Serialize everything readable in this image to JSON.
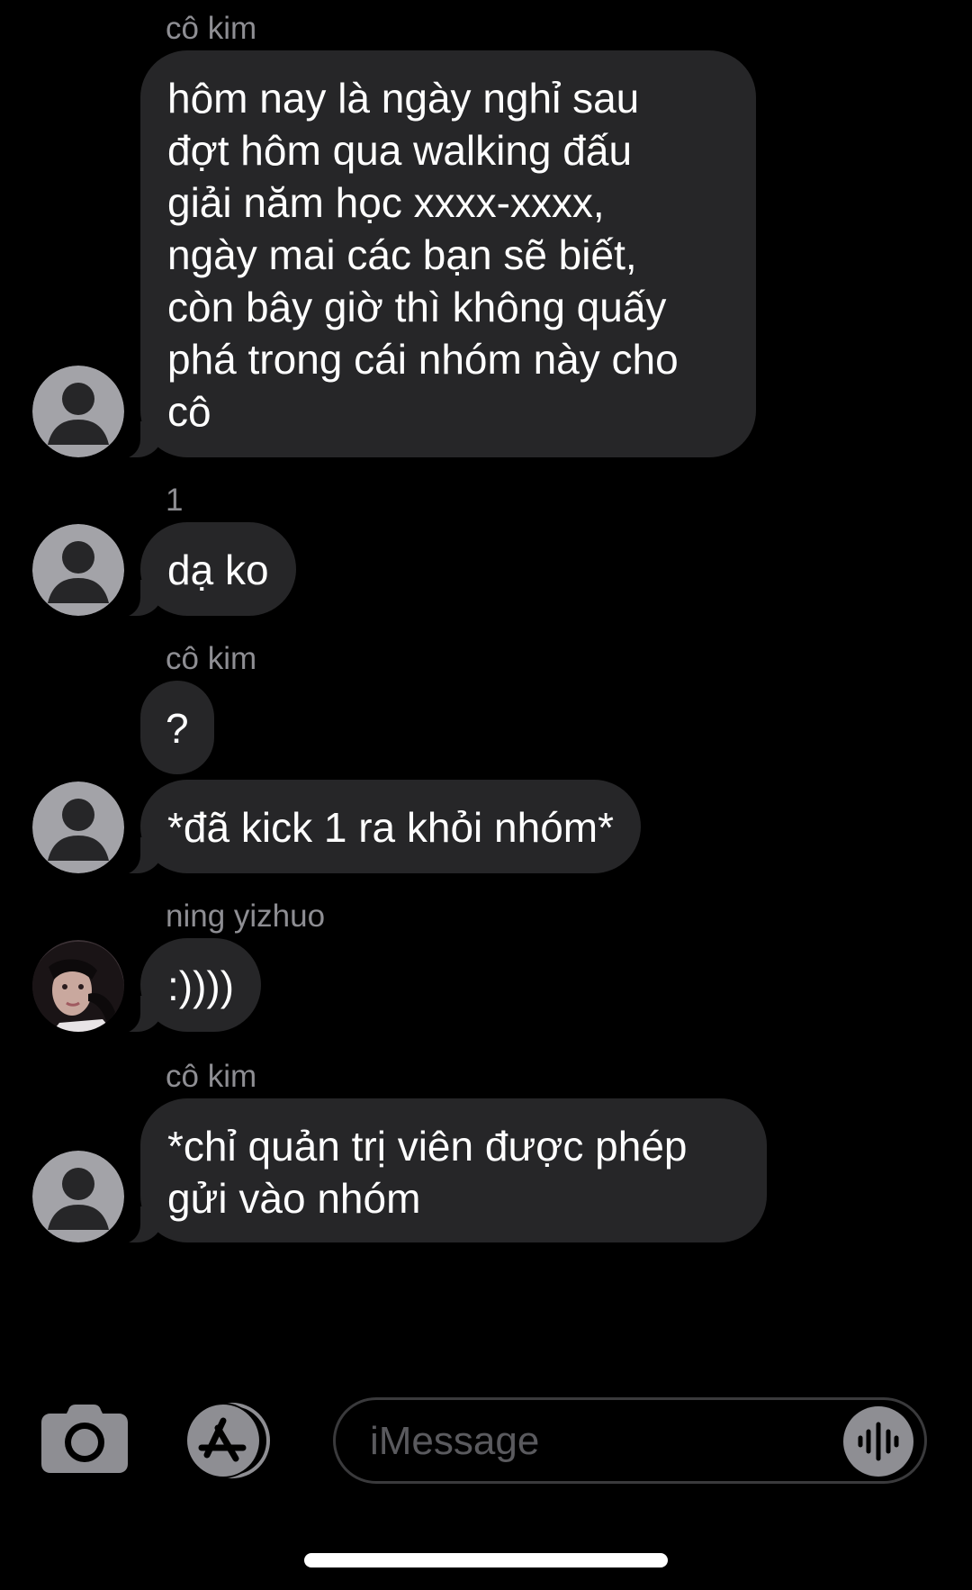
{
  "messages": [
    {
      "sender": "cô kim",
      "text": "hôm nay là ngày nghỉ sau\nđợt hôm qua walking đấu\ngiải năm học xxxx-xxxx,\nngày mai các bạn sẽ biết,\ncòn bây giờ thì không quấy\nphá trong cái nhóm này cho\ncô"
    },
    {
      "sender": "1",
      "text": "dạ ko"
    },
    {
      "sender": "cô kim",
      "text": "?"
    },
    {
      "text": "*đã kick 1 ra khỏi nhóm*"
    },
    {
      "sender": "ning yizhuo",
      "text": ":))))"
    },
    {
      "sender": "cô kim",
      "text": "*chỉ quản trị viên được phép\ngửi vào nhóm"
    }
  ],
  "input": {
    "placeholder": "iMessage"
  },
  "icons": {
    "camera": "camera-icon",
    "apps": "app-store-icon",
    "voice": "waveform-icon",
    "avatar_default": "person-icon",
    "avatar_photo": "user-photo"
  },
  "colors": {
    "background": "#000000",
    "bubble": "#262628",
    "sender_label": "#8e8e93",
    "avatar_bg": "#a3a3a8",
    "avatar_fg": "#262628"
  }
}
